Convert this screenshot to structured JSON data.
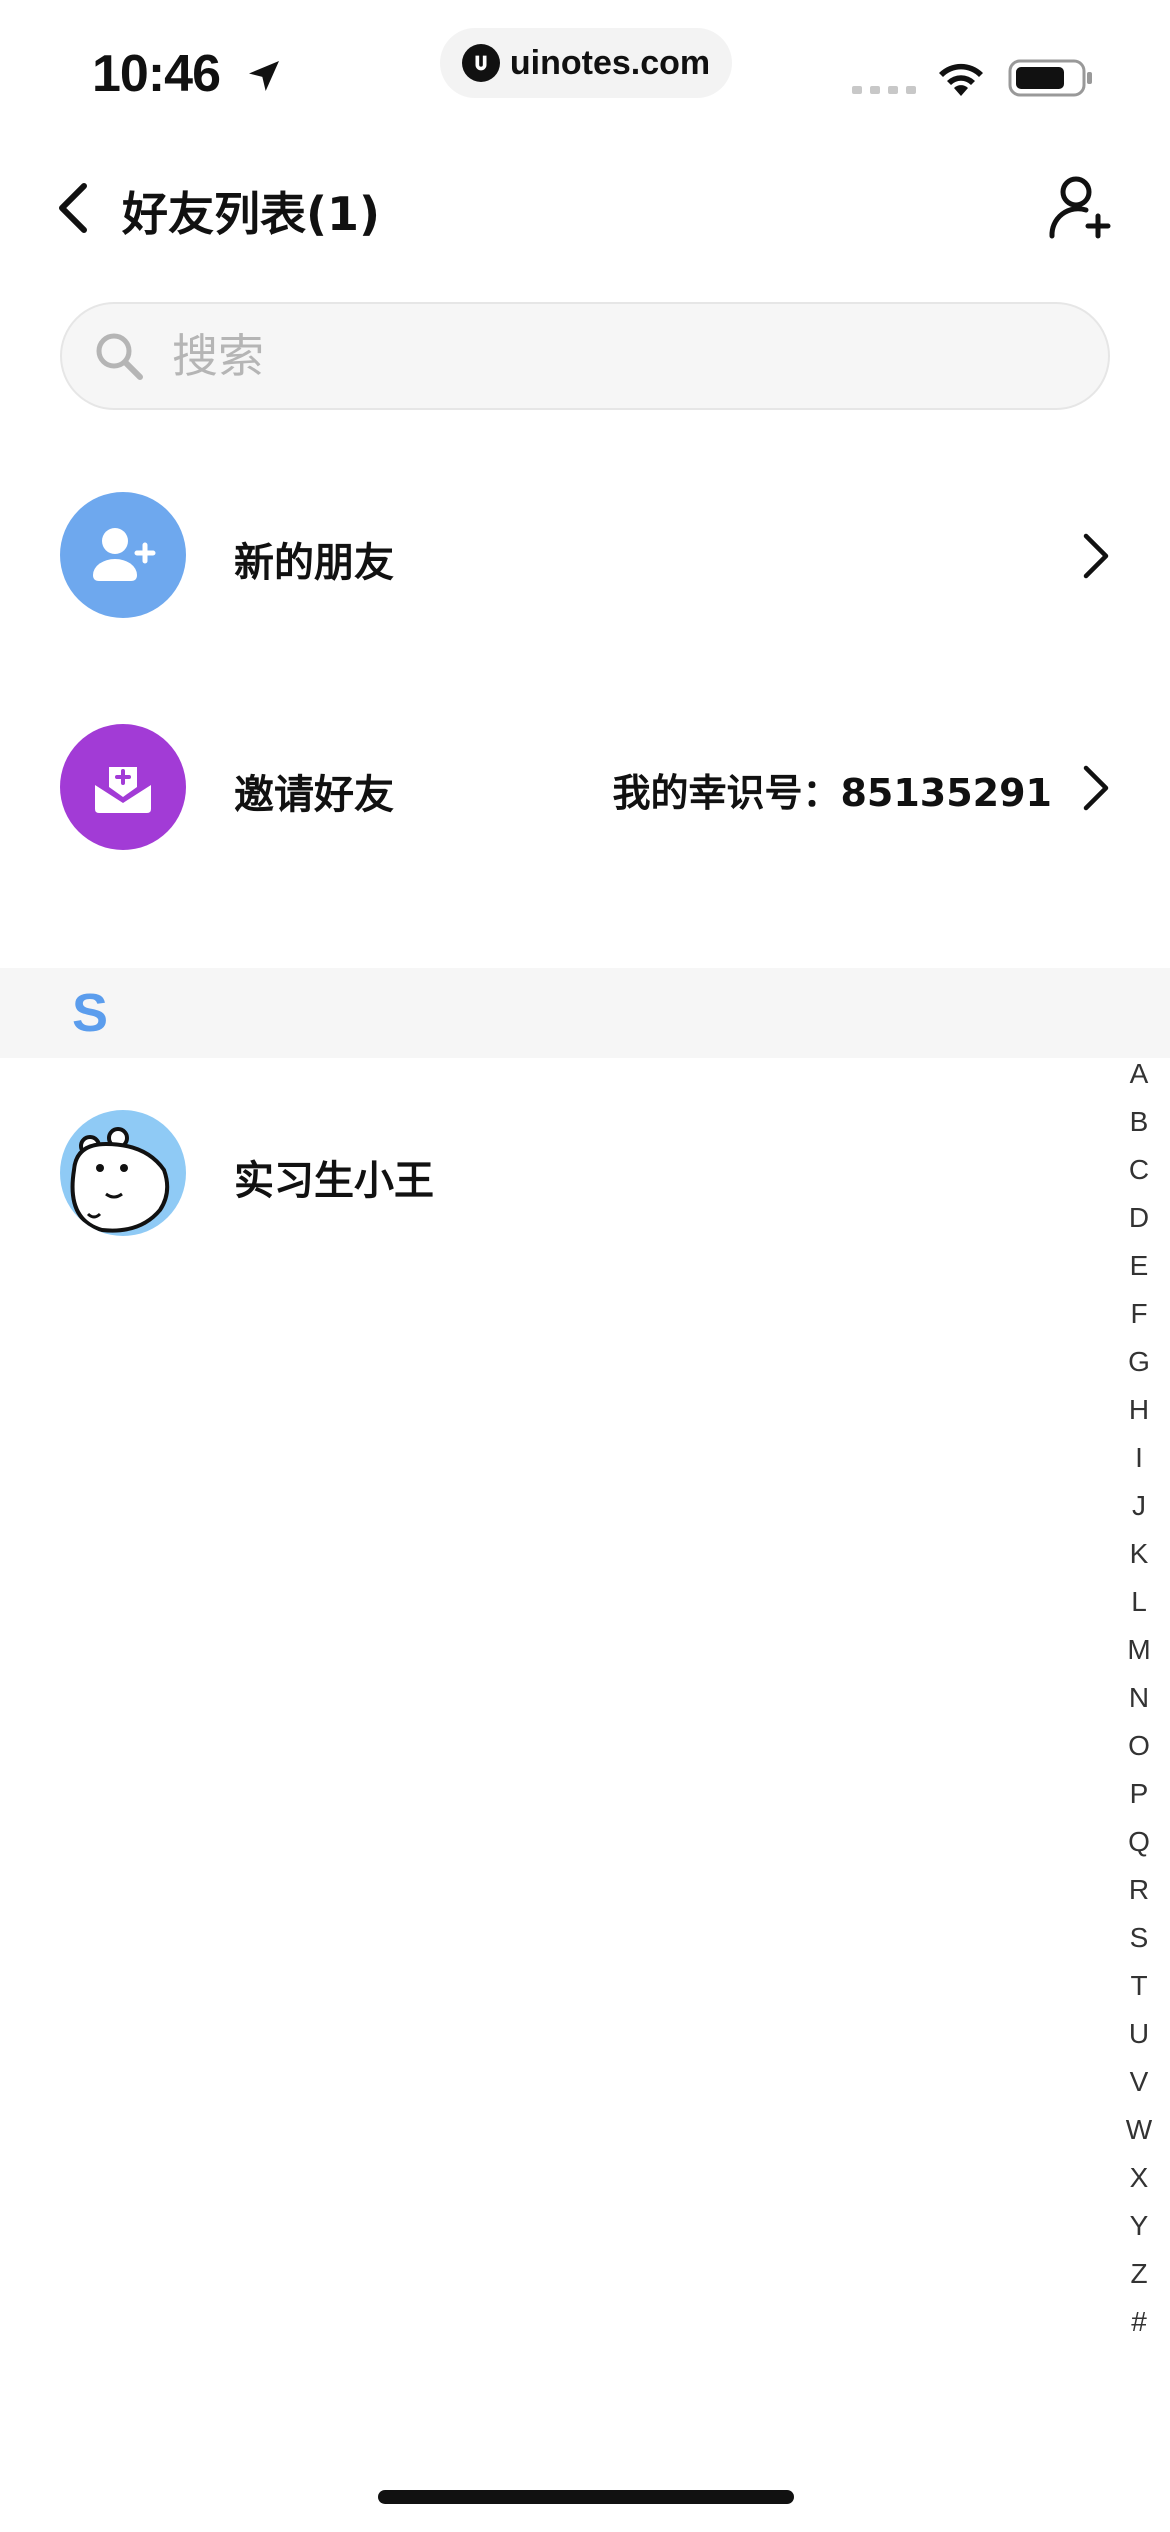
{
  "status_bar": {
    "time": "10:46",
    "url": "uinotes.com"
  },
  "header": {
    "title": "好友列表(1)"
  },
  "search": {
    "placeholder": "搜索"
  },
  "menu": {
    "new_friends": {
      "label": "新的朋友",
      "icon_color": "#6ea8ee"
    },
    "invite": {
      "label": "邀请好友",
      "id_text": "我的幸识号：85135291",
      "icon_color": "#a23bd6"
    }
  },
  "sections": [
    {
      "letter": "S",
      "contacts": [
        {
          "name": "实习生小王"
        }
      ]
    }
  ],
  "alphabet_index": [
    "A",
    "B",
    "C",
    "D",
    "E",
    "F",
    "G",
    "H",
    "I",
    "J",
    "K",
    "L",
    "M",
    "N",
    "O",
    "P",
    "Q",
    "R",
    "S",
    "T",
    "U",
    "V",
    "W",
    "X",
    "Y",
    "Z",
    "#"
  ],
  "colors": {
    "accent_blue": "#5b9ded",
    "section_bg": "#f6f6f6"
  }
}
